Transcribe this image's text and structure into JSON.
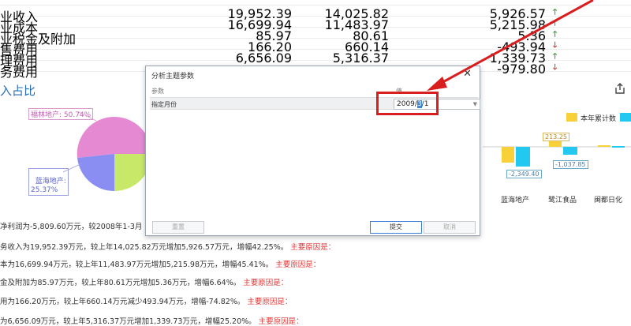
{
  "table_rows": [
    {
      "label": "",
      "v1": "",
      "v2": "",
      "v3": "",
      "trend": ""
    },
    {
      "label": "业收入",
      "v1": "19,952.39",
      "v2": "14,025.82",
      "v3": "5,926.57",
      "trend": "up"
    },
    {
      "label": "业成本",
      "v1": "16,699.94",
      "v2": "11,483.97",
      "v3": "5,215.98",
      "trend": "up"
    },
    {
      "label": "业税金及附加",
      "v1": "85.97",
      "v2": "80.61",
      "v3": "5.36",
      "trend": "up"
    },
    {
      "label": "售费用",
      "v1": "166.20",
      "v2": "660.14",
      "v3": "-493.94",
      "trend": "down"
    },
    {
      "label": "理费用",
      "v1": "6,656.09",
      "v2": "5,316.37",
      "v3": "1,339.73",
      "trend": "up"
    },
    {
      "label": "务费用",
      "v1": "",
      "v2": "",
      "v3": "-979.80",
      "trend": "down"
    }
  ],
  "section": {
    "title": "入占比"
  },
  "pie": {
    "labels": [
      "福林地产: 50.74%",
      "蓝海地产:\n25.37%"
    ],
    "colors": {
      "pink": "#e58ad2",
      "blue": "#8a8ef2",
      "green": "#c8e86a",
      "teal": "#5dd6c0"
    }
  },
  "bar_chart": {
    "legend": "本年累计数",
    "legend_colors": {
      "yellow": "#f7d03a",
      "cyan": "#22c8f0"
    },
    "categories": [
      "蓝海地产",
      "鹭江食品",
      "闽都日化"
    ],
    "value_labels": [
      "213.25",
      "-2,349.40",
      "-1,037.85"
    ]
  },
  "text_lines": [
    {
      "text": "净利润为-5,809.60万元，较2008年1-3月",
      "red": ""
    },
    {
      "text": "务收入为19,952.39万元，较上年14,025.82万元增加5,926.57万元，增幅42.25%。",
      "red": "主要原因是："
    },
    {
      "text": "本为16,699.94万元，较上年11,483.97万元增加5,215.98万元，增幅45.41%。",
      "red": "主要原因是："
    },
    {
      "text": "金及附加为85.97万元，较上年80.61万元增加5.36万元，增幅6.64%。",
      "red": "主要原因是："
    },
    {
      "text": "用为166.20万元，较上年660.14万元减少493.94万元，增幅-74.82%。",
      "red": "主要原因是："
    },
    {
      "text": "为6,656.09万元，较上年5,316.37万元增加1,339.73万元，增幅25.20%。",
      "red": "主要原因是："
    }
  ],
  "dialog": {
    "title": "分析主题参数",
    "close": "✕",
    "col_param": "参数",
    "col_value": "值",
    "param_name": "指定月份",
    "value_before": "2009/",
    "value_selected": "3",
    "value_after": "/1",
    "reset_label": "重置",
    "submit_label": "提交",
    "cancel_label": "取消"
  }
}
